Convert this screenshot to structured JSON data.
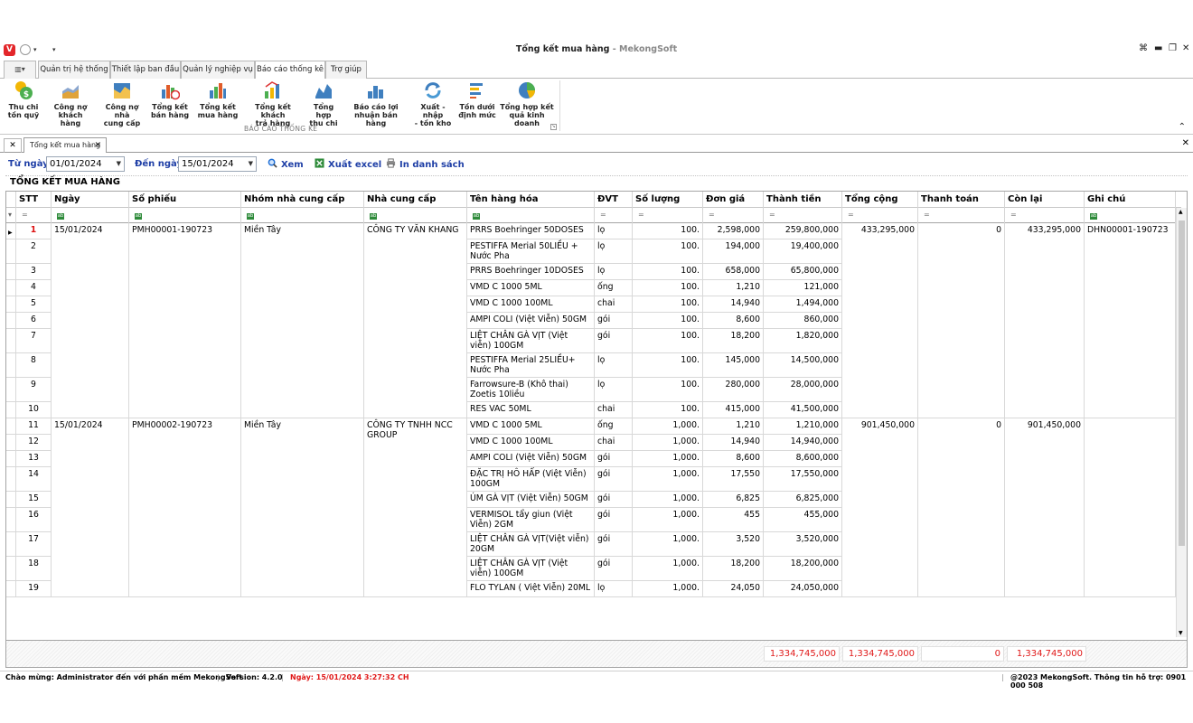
{
  "window": {
    "logo_letter": "V",
    "title": "Tổng kết mua hàng",
    "title_suffix": "MekongSoft",
    "title_sep": " - "
  },
  "ribbon_tabs": [
    "Quản trị hệ thống",
    "Thiết lập ban đầu",
    "Quản lý nghiệp vụ",
    "Báo cáo thống kê",
    "Trợ giúp"
  ],
  "ribbon_menu_label": "▥▾",
  "ribbon_buttons": [
    {
      "label": "Thu chi\ntồn quỹ",
      "icon": "coins-icon"
    },
    {
      "label": "Công nợ\nkhách hàng",
      "icon": "area-chart-icon"
    },
    {
      "label": "Công nợ nhà\ncung cấp",
      "icon": "area-chart-alt-icon"
    },
    {
      "label": "Tổng kết\nbán hàng",
      "icon": "bar-clock-icon"
    },
    {
      "label": "Tổng kết\nmua hàng",
      "icon": "bar-chart-icon"
    },
    {
      "label": "Tổng kết khách\ntrả hàng",
      "icon": "return-chart-icon"
    },
    {
      "label": "Tổng hợp\nthu chi",
      "icon": "line-chart-icon"
    },
    {
      "label": "Báo cáo lợi\nnhuận bán hàng",
      "icon": "profit-chart-icon"
    },
    {
      "label": "Xuất - nhập\n- tồn kho",
      "icon": "refresh-icon"
    },
    {
      "label": "Tồn dưới\nđịnh mức",
      "icon": "list-bars-icon"
    },
    {
      "label": "Tổng hợp kết\nquả kinh doanh",
      "icon": "pie-chart-icon"
    }
  ],
  "ribbon_group_label": "BÁO CÁO THỐNG KÊ",
  "doc_tab": "Tổng kết mua hàng",
  "filters": {
    "from_label": "Từ ngày",
    "from_value": "01/01/2024",
    "to_label": "Đến ngày",
    "to_value": "15/01/2024",
    "view_label": "Xem",
    "excel_label": "Xuất excel",
    "print_label": "In danh sách"
  },
  "section_title": "TỔNG KẾT MUA HÀNG",
  "columns": [
    "STT",
    "Ngày",
    "Số phiếu",
    "Nhóm nhà cung cấp",
    "Nhà cung cấp",
    "Tên hàng hóa",
    "ĐVT",
    "Số lượng",
    "Đơn giá",
    "Thành tiền",
    "Tổng cộng",
    "Thanh toán",
    "Còn lại",
    "Ghi chú"
  ],
  "groups": [
    {
      "date": "15/01/2024",
      "voucher": "PMH00001-190723",
      "supplier_group": "Miền Tây",
      "supplier": "CÔNG TY VĂN KHANG",
      "total": "433,295,000",
      "paid": "0",
      "remaining": "433,295,000",
      "note": "DHN00001-190723",
      "items": [
        {
          "stt": "1",
          "name": "PRRS Boehringer 50DOSES",
          "unit": "lọ",
          "qty": "100.",
          "price": "2,598,000",
          "amount": "259,800,000"
        },
        {
          "stt": "2",
          "name": "PESTIFFA Merial 50LIỀU + Nước Pha",
          "unit": "lọ",
          "qty": "100.",
          "price": "194,000",
          "amount": "19,400,000"
        },
        {
          "stt": "3",
          "name": "PRRS Boehringer 10DOSES",
          "unit": "lọ",
          "qty": "100.",
          "price": "658,000",
          "amount": "65,800,000"
        },
        {
          "stt": "4",
          "name": "VMD C 1000 5ML",
          "unit": "ống",
          "qty": "100.",
          "price": "1,210",
          "amount": "121,000"
        },
        {
          "stt": "5",
          "name": "VMD C 1000 100ML",
          "unit": "chai",
          "qty": "100.",
          "price": "14,940",
          "amount": "1,494,000"
        },
        {
          "stt": "6",
          "name": "AMPI COLI (Việt Viễn) 50GM",
          "unit": "gói",
          "qty": "100.",
          "price": "8,600",
          "amount": "860,000"
        },
        {
          "stt": "7",
          "name": "LIỆT CHÂN GÀ VỊT (Việt viễn) 100GM",
          "unit": "gói",
          "qty": "100.",
          "price": "18,200",
          "amount": "1,820,000"
        },
        {
          "stt": "8",
          "name": "PESTIFFA Merial 25LIỀU+ Nước Pha",
          "unit": "lọ",
          "qty": "100.",
          "price": "145,000",
          "amount": "14,500,000"
        },
        {
          "stt": "9",
          "name": "Farrowsure-B (Khô thai) Zoetis 10liều",
          "unit": "lọ",
          "qty": "100.",
          "price": "280,000",
          "amount": "28,000,000"
        },
        {
          "stt": "10",
          "name": "RES VAC 50ML",
          "unit": "chai",
          "qty": "100.",
          "price": "415,000",
          "amount": "41,500,000"
        }
      ]
    },
    {
      "date": "15/01/2024",
      "voucher": "PMH00002-190723",
      "supplier_group": "Miền Tây",
      "supplier": "CÔNG TY TNHH NCC GROUP",
      "total": "901,450,000",
      "paid": "0",
      "remaining": "901,450,000",
      "note": "",
      "items": [
        {
          "stt": "11",
          "name": "VMD C 1000 5ML",
          "unit": "ống",
          "qty": "1,000.",
          "price": "1,210",
          "amount": "1,210,000"
        },
        {
          "stt": "12",
          "name": "VMD C 1000 100ML",
          "unit": "chai",
          "qty": "1,000.",
          "price": "14,940",
          "amount": "14,940,000"
        },
        {
          "stt": "13",
          "name": "AMPI COLI (Việt Viễn) 50GM",
          "unit": "gói",
          "qty": "1,000.",
          "price": "8,600",
          "amount": "8,600,000"
        },
        {
          "stt": "14",
          "name": "ĐẶC TRỊ HÔ HẤP (Việt Viễn) 100GM",
          "unit": "gói",
          "qty": "1,000.",
          "price": "17,550",
          "amount": "17,550,000"
        },
        {
          "stt": "15",
          "name": "ÚM GÀ VỊT (Việt Viễn) 50GM",
          "unit": "gói",
          "qty": "1,000.",
          "price": "6,825",
          "amount": "6,825,000"
        },
        {
          "stt": "16",
          "name": "VERMISOL tẩy giun (Việt Viễn) 2GM",
          "unit": "gói",
          "qty": "1,000.",
          "price": "455",
          "amount": "455,000"
        },
        {
          "stt": "17",
          "name": "LIỆT CHÂN GÀ VỊT(Việt viễn) 20GM",
          "unit": "gói",
          "qty": "1,000.",
          "price": "3,520",
          "amount": "3,520,000"
        },
        {
          "stt": "18",
          "name": "LIỆT CHÂN GÀ VỊT (Việt viễn) 100GM",
          "unit": "gói",
          "qty": "1,000.",
          "price": "18,200",
          "amount": "18,200,000"
        },
        {
          "stt": "19",
          "name": "FLO TYLAN ( Việt Viễn) 20ML",
          "unit": "lọ",
          "qty": "1,000.",
          "price": "24,050",
          "amount": "24,050,000"
        }
      ]
    }
  ],
  "footer": {
    "amount_sum": "1,334,745,000",
    "total_sum": "1,334,745,000",
    "paid_sum": "0",
    "remaining_sum": "1,334,745,000"
  },
  "status": {
    "welcome": "Chào mừng: Administrator đến với phần mềm MekongSoft",
    "version": "Version: 4.2.0",
    "date": "Ngày: 15/01/2024 3:27:32 CH",
    "copyright": "@2023 MekongSoft. Thông tin hỗ trợ: 0901 000 508"
  },
  "colors": {
    "accent_blue": "#1f3fa6",
    "total_red": "#e01919",
    "logo_red": "#e3262a"
  }
}
